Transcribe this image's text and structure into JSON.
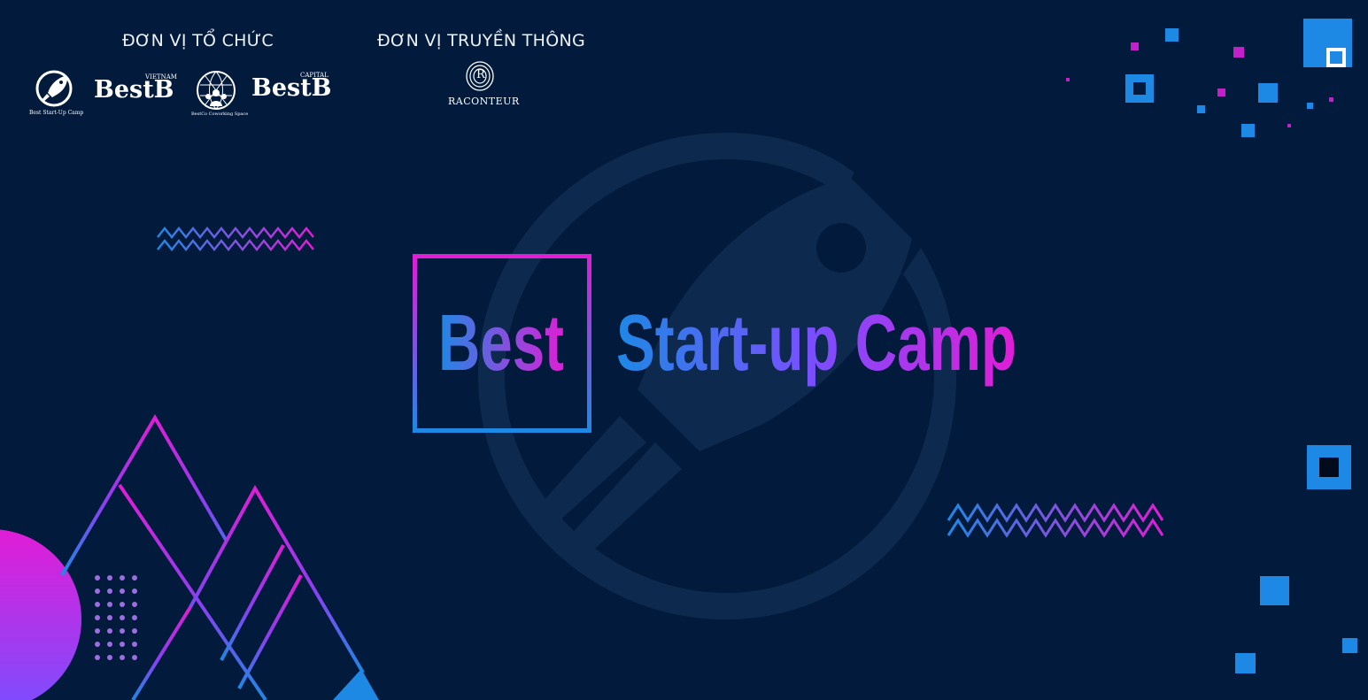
{
  "header": {
    "organizers_label": "ĐƠN VỊ TỔ CHỨC",
    "media_label": "ĐƠN VỊ TRUYỀN THÔNG"
  },
  "organizer_logos": [
    {
      "name": "Best Start-Up Camp",
      "caption": "Best Start-Up Camp"
    },
    {
      "name": "BestB Vietnam",
      "wordmark": "BestB",
      "superscript": "VIETNAM"
    },
    {
      "name": "BestCo Coworking Space",
      "caption": "BestCo Coworking Space"
    },
    {
      "name": "BestB Capital",
      "wordmark": "BestB",
      "superscript": "CAPITAL"
    }
  ],
  "media_logos": [
    {
      "name": "Raconteur",
      "wordmark": "RACONTEUR",
      "monogram": "R"
    }
  ],
  "headline": {
    "boxed_word": "Best",
    "rest": "Start-up Camp"
  },
  "colors": {
    "background": "#021a3b",
    "blue": "#1e88e5",
    "magenta": "#e11dd6",
    "violet": "#7c4dff"
  }
}
